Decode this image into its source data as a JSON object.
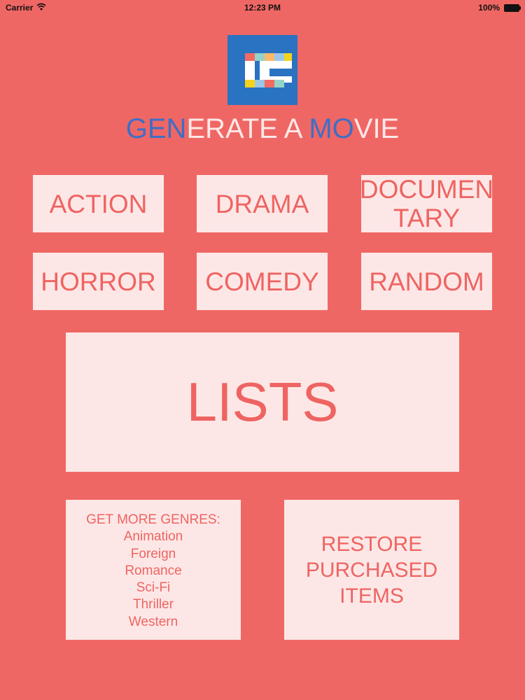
{
  "status_bar": {
    "carrier": "Carrier",
    "time": "12:23 PM",
    "battery": "100%"
  },
  "app": {
    "title_parts": [
      {
        "text": "GEN",
        "color": "#3e6ec7"
      },
      {
        "text": "ERATE A ",
        "color": "#fde8e7"
      },
      {
        "text": "MO",
        "color": "#3e6ec7"
      },
      {
        "text": "VIE",
        "color": "#fde8e7"
      }
    ],
    "logo_icon": "generate-a-movie-logo-icon"
  },
  "genres": {
    "action": "ACTION",
    "drama": "DRAMA",
    "documentary_line1": "DOCUMEN",
    "documentary_line2": "TARY",
    "horror": "HORROR",
    "comedy": "COMEDY",
    "random": "RANDOM"
  },
  "lists_label": "LISTS",
  "more_genres": {
    "title": "GET MORE GENRES:",
    "items": [
      "Animation",
      "Foreign",
      "Romance",
      "Sci-Fi",
      "Thriller",
      "Western"
    ]
  },
  "restore": {
    "line1": "RESTORE",
    "line2": "PURCHASED",
    "line3": "ITEMS"
  },
  "colors": {
    "background": "#ef6764",
    "button_bg": "#fde7e6",
    "button_text": "#ee6462",
    "logo_bg": "#2a72c2"
  }
}
